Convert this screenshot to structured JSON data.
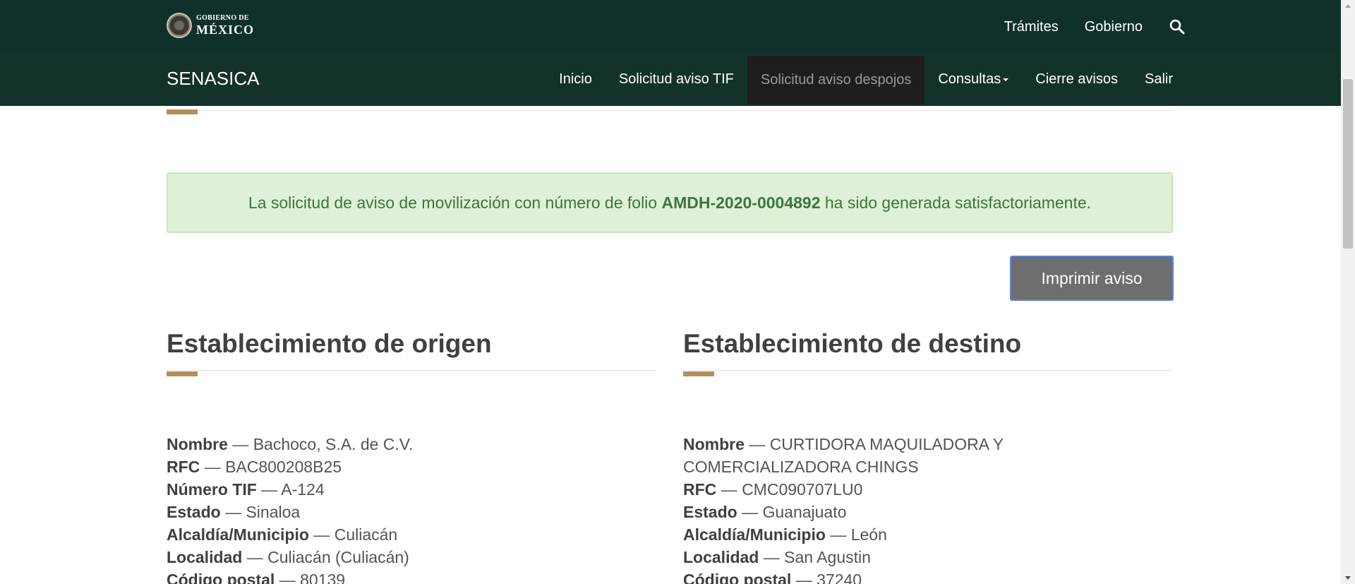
{
  "gob_header": {
    "logo_small": "GOBIERNO DE",
    "logo_big": "MÉXICO",
    "nav": [
      "Trámites",
      "Gobierno"
    ]
  },
  "app_header": {
    "brand": "SENASICA",
    "nav": [
      {
        "label": "Inicio"
      },
      {
        "label": "Solicitud aviso TIF"
      },
      {
        "label": "Solicitud aviso despojos"
      },
      {
        "label": "Consultas"
      },
      {
        "label": "Cierre avisos"
      },
      {
        "label": "Salir"
      }
    ]
  },
  "alert": {
    "prefix": "La solicitud de aviso de movilización con número de folio ",
    "folio": "AMDH-2020-0004892",
    "suffix": " ha sido generada satisfactoriamente."
  },
  "print_button": "Imprimir aviso",
  "origin": {
    "title": "Establecimiento de origen",
    "fields": [
      {
        "label": "Nombre",
        "sep": " — ",
        "value": "Bachoco, S.A. de C.V."
      },
      {
        "label": "RFC",
        "sep": " — ",
        "value": "BAC800208B25"
      },
      {
        "label": "Número TIF",
        "sep": " — ",
        "value": "A-124"
      },
      {
        "label": "Estado",
        "sep": " — ",
        "value": "Sinaloa"
      },
      {
        "label": "Alcaldía/Municipio",
        "sep": " — ",
        "value": "Culiacán"
      },
      {
        "label": "Localidad",
        "sep": " — ",
        "value": "Culiacán (Culiacán)"
      },
      {
        "label": "Código postal",
        "sep": " — ",
        "value": "80139"
      }
    ]
  },
  "destination": {
    "title": "Establecimiento de destino",
    "fields": [
      {
        "label": "Nombre",
        "sep": " — ",
        "value": "CURTIDORA MAQUILADORA Y COMERCIALIZADORA CHINGS"
      },
      {
        "label": "RFC",
        "sep": " — ",
        "value": "CMC090707LU0"
      },
      {
        "label": "Estado",
        "sep": " — ",
        "value": "Guanajuato"
      },
      {
        "label": "Alcaldía/Municipio",
        "sep": " — ",
        "value": "León"
      },
      {
        "label": "Localidad",
        "sep": " — ",
        "value": "San Agustin"
      },
      {
        "label": "Código postal",
        "sep": " — ",
        "value": "37240"
      }
    ]
  },
  "colors": {
    "gob_bar": "#10312b",
    "app_bar": "#13322b",
    "accent": "#b38e5d",
    "alert_bg": "#dff0d8",
    "alert_text": "#3c763d"
  }
}
